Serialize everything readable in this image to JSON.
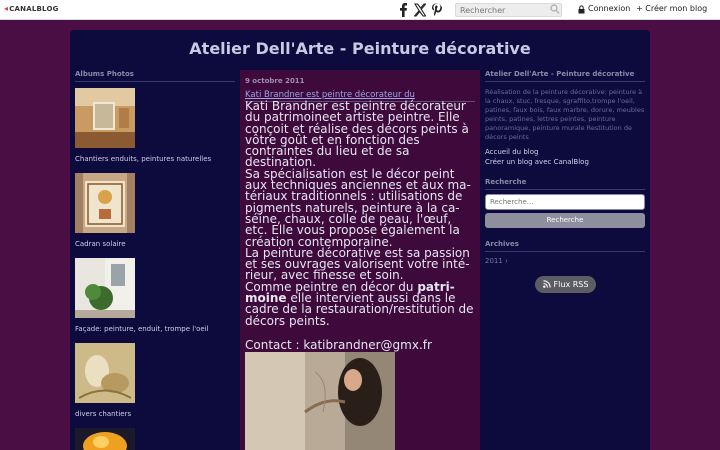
{
  "topbar": {
    "logo": "CANALBLOG",
    "search_placeholder": "Rechercher",
    "login": "Connexion",
    "create_blog": "+ Créer mon blog"
  },
  "site": {
    "title": "Atelier Dell'Arte - Peinture décorative"
  },
  "left": {
    "heading": "Albums Photos",
    "albums": [
      {
        "caption": "Chantiers enduits, peintures naturelles"
      },
      {
        "caption": "Cadran solaire"
      },
      {
        "caption": "Façade: peinture, enduit, trompe l'oeil"
      },
      {
        "caption": "divers chantiers"
      }
    ]
  },
  "post": {
    "date": "9 octobre 2011",
    "title": "Kati Brandner est peintre décorateur du",
    "p1": "Kati Brandner est peintre décorateur du patrimoineet artiste peintre. Elle conçoit et réalise des décors peints à vôtre goût et en fonction des contraintes du lieu et de sa destination.",
    "p2": "Sa spécialisation  est le décor peint aux techniques anciennes et aux ma-tériaux traditionnels : utilisations de pigments naturels, peinture à la ca-séine, chaux, colle de peau, l'œuf, etc. Elle vous propose également la création contemporaine.",
    "p3": "La peinture décorative est sa passion et ses ouvrages valorisent votre inté-rieur, avec finesse et soin.",
    "p4_a": "Comme peintre en décor du ",
    "p4_b": "patri-moine",
    "p4_c": " elle intervient aussi dans le cadre de la restauration/restitution de décors peints.",
    "contact": "Contact : katibrandner@gmx.fr"
  },
  "right": {
    "heading": "Atelier Dell'Arte - Peinture décorative",
    "description": "Réalisation de la peinture décorative: peinture à la chaux, stuc, fresque, sgraffito,trompe l'oeil, patines, faux bois, faux marbre, dorure, meubles peints, patines, lettres peintes, peinture panoramique, peinture murale Restitution de décors peints",
    "link_home": "Accueil du blog",
    "link_create": "Créer un blog avec CanalBlog",
    "search_heading": "Recherche",
    "search_placeholder": "Recherche...",
    "search_button": "Recherche",
    "archives_heading": "Archives",
    "archive_year": "2011",
    "rss": "Flux RSS"
  }
}
